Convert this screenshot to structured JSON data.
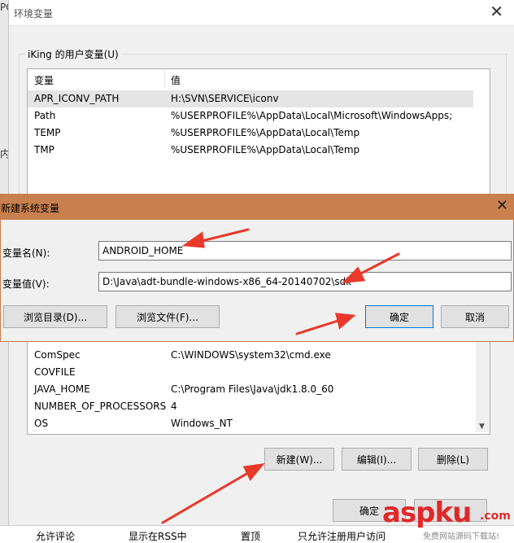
{
  "left_fragments": [
    "PC",
    "内"
  ],
  "window": {
    "title": "环境变量",
    "user_group_label": "iKing 的用户变量(U)",
    "columns": {
      "variable": "变量",
      "value": "值"
    },
    "user_vars": [
      {
        "name": "APR_ICONV_PATH",
        "value": "H:\\SVN\\SERVICE\\iconv"
      },
      {
        "name": "Path",
        "value": "%USERPROFILE%\\AppData\\Local\\Microsoft\\WindowsApps;"
      },
      {
        "name": "TEMP",
        "value": "%USERPROFILE%\\AppData\\Local\\Temp"
      },
      {
        "name": "TMP",
        "value": "%USERPROFILE%\\AppData\\Local\\Temp"
      }
    ],
    "system_vars": [
      {
        "name": "ComSpec",
        "value": "C:\\WINDOWS\\system32\\cmd.exe"
      },
      {
        "name": "COVFILE",
        "value": ""
      },
      {
        "name": "JAVA_HOME",
        "value": "C:\\Program Files\\Java\\jdk1.8.0_60"
      },
      {
        "name": "NUMBER_OF_PROCESSORS",
        "value": "4"
      },
      {
        "name": "OS",
        "value": "Windows_NT"
      }
    ],
    "buttons": {
      "new": "新建(W)...",
      "edit": "编辑(I)...",
      "delete": "删除(L)",
      "ok": "确定"
    }
  },
  "dialog": {
    "title": "新建系统变量",
    "name_label": "变量名(N):",
    "name_value": "ANDROID_HOME",
    "value_label": "变量值(V):",
    "value_value": "D:\\Java\\adt-bundle-windows-x86_64-20140702\\sdk",
    "browse_dir": "浏览目录(D)...",
    "browse_file": "浏览文件(F)...",
    "ok": "确定",
    "cancel": "取消"
  },
  "background_page": {
    "checkboxes": [
      "允许评论",
      "显示在RSS中",
      "置顶",
      "只允许注册用户访问"
    ]
  },
  "watermark": {
    "brand": "aspku",
    "tld": ".com",
    "tagline": "免费网站源码下载站!"
  },
  "colors": {
    "dialog_title": "#c9804f",
    "arrow": "#e8392b",
    "watermark": "#e0282a"
  }
}
